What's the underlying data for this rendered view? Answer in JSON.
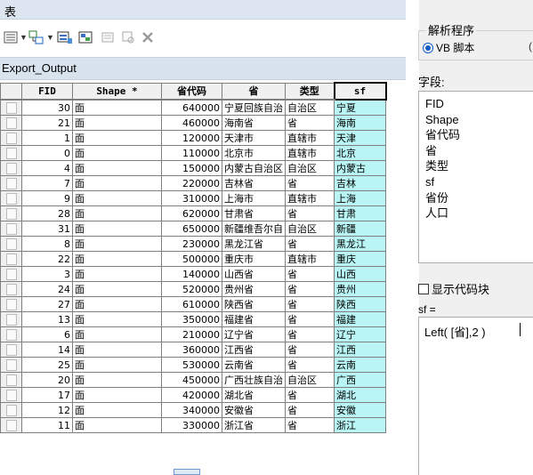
{
  "window": {
    "title": "表"
  },
  "layer": {
    "name": "Export_Output"
  },
  "table": {
    "columns": [
      "FID",
      "Shape *",
      "省代码",
      "省",
      "类型",
      "sf"
    ],
    "rows": [
      [
        "30",
        "面",
        "640000",
        "宁夏回族自治",
        "自治区",
        "宁夏"
      ],
      [
        "21",
        "面",
        "460000",
        "海南省",
        "省",
        "海南"
      ],
      [
        "1",
        "面",
        "120000",
        "天津市",
        "直辖市",
        "天津"
      ],
      [
        "0",
        "面",
        "110000",
        "北京市",
        "直辖市",
        "北京"
      ],
      [
        "4",
        "面",
        "150000",
        "内蒙古自治区",
        "自治区",
        "内蒙古"
      ],
      [
        "7",
        "面",
        "220000",
        "吉林省",
        "省",
        "吉林"
      ],
      [
        "9",
        "面",
        "310000",
        "上海市",
        "直辖市",
        "上海"
      ],
      [
        "28",
        "面",
        "620000",
        "甘肃省",
        "省",
        "甘肃"
      ],
      [
        "31",
        "面",
        "650000",
        "新疆维吾尔自",
        "自治区",
        "新疆"
      ],
      [
        "8",
        "面",
        "230000",
        "黑龙江省",
        "省",
        "黑龙江"
      ],
      [
        "22",
        "面",
        "500000",
        "重庆市",
        "直辖市",
        "重庆"
      ],
      [
        "3",
        "面",
        "140000",
        "山西省",
        "省",
        "山西"
      ],
      [
        "24",
        "面",
        "520000",
        "贵州省",
        "省",
        "贵州"
      ],
      [
        "27",
        "面",
        "610000",
        "陕西省",
        "省",
        "陕西"
      ],
      [
        "13",
        "面",
        "350000",
        "福建省",
        "省",
        "福建"
      ],
      [
        "6",
        "面",
        "210000",
        "辽宁省",
        "省",
        "辽宁"
      ],
      [
        "14",
        "面",
        "360000",
        "江西省",
        "省",
        "江西"
      ],
      [
        "25",
        "面",
        "530000",
        "云南省",
        "省",
        "云南"
      ],
      [
        "20",
        "面",
        "450000",
        "广西壮族自治",
        "自治区",
        "广西"
      ],
      [
        "17",
        "面",
        "420000",
        "湖北省",
        "省",
        "湖北"
      ],
      [
        "12",
        "面",
        "340000",
        "安徽省",
        "省",
        "安徽"
      ],
      [
        "11",
        "面",
        "330000",
        "浙江省",
        "省",
        "浙江"
      ]
    ]
  },
  "calculator": {
    "parser_title": "解析程序",
    "parser_vb": "VB 脚本",
    "parser_python": "(",
    "fields_label": "字段:",
    "fields": [
      "FID",
      "Shape",
      "省代码",
      "省",
      "类型",
      "sf",
      "省份",
      "人口"
    ],
    "show_codeblock": "显示代码块",
    "target_label": "sf =",
    "expression": "Left( [省],2 )"
  },
  "colors": {
    "highlight": "#b9f5f5",
    "accent": "#0a5bc4"
  }
}
